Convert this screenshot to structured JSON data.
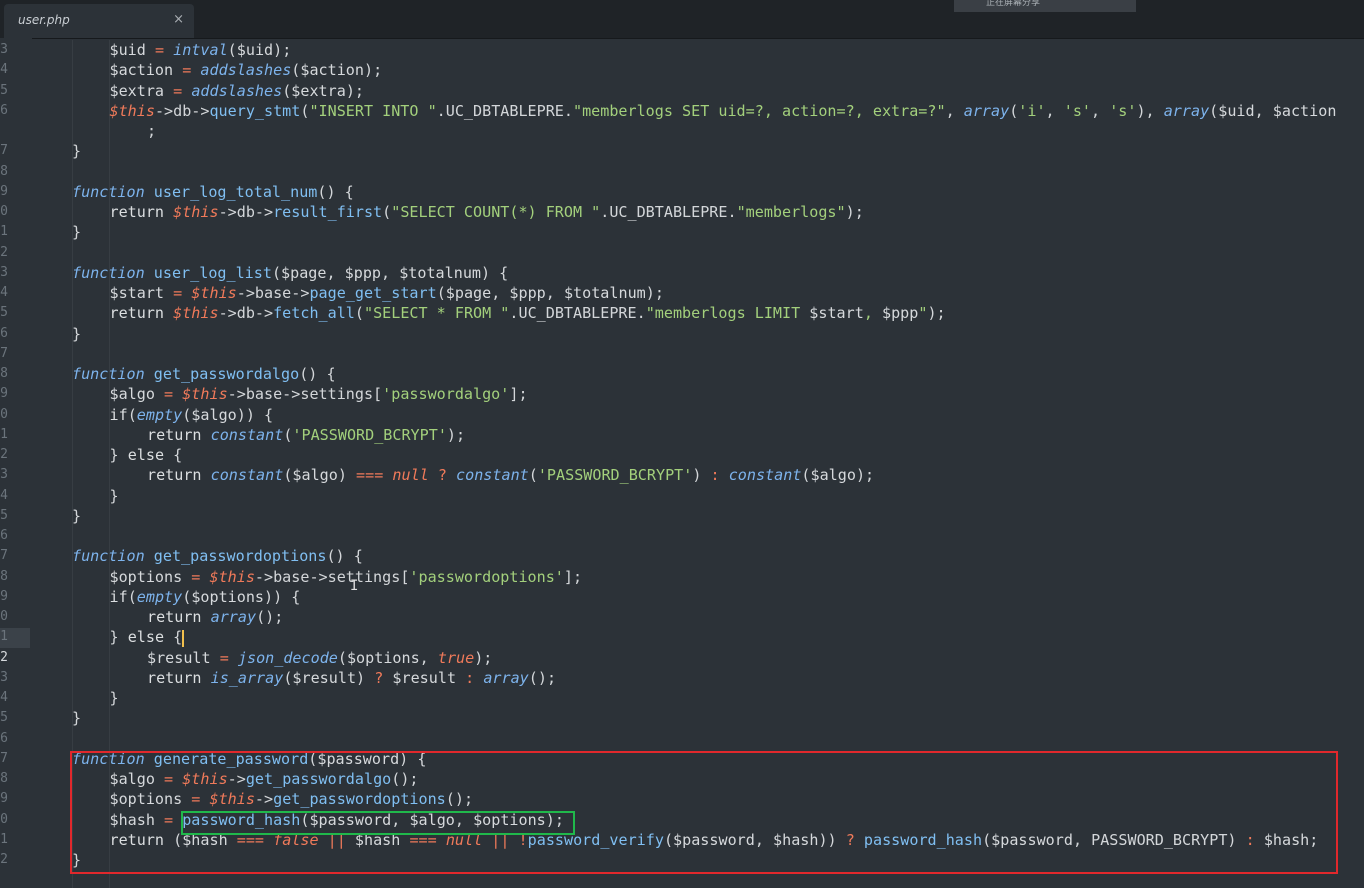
{
  "tab": {
    "title": "user.php",
    "close": "×"
  },
  "notice": {
    "text": "正在屏幕分享"
  },
  "line_numbers": [
    "3",
    "4",
    "5",
    "6",
    "",
    "7",
    "8",
    "9",
    "0",
    "1",
    "2",
    "3",
    "4",
    "5",
    "6",
    "7",
    "8",
    "9",
    "0",
    "1",
    "2",
    "3",
    "4",
    "5",
    "6",
    "7",
    "8",
    "9",
    "0",
    "1",
    "2",
    "3",
    "4",
    "5",
    "6",
    "7",
    "8",
    "9",
    "0",
    "1",
    "2"
  ],
  "code": {
    "l1": "$uid = intval($uid);",
    "l2": "$action = addslashes($action);",
    "l3": "$extra = addslashes($extra);",
    "l4": "$this->db->query_stmt(\"INSERT INTO \".UC_DBTABLEPRE.\"memberlogs SET uid=?, action=?, extra=?\", array('i', 's', 's'), array($uid, $action",
    "l5": ";",
    "l6": "}",
    "l7": "function user_log_total_num() {",
    "l8": "return $this->db->result_first(\"SELECT COUNT(*) FROM \".UC_DBTABLEPRE.\"memberlogs\");",
    "l9": "}",
    "l10": "function user_log_list($page, $ppp, $totalnum) {",
    "l11": "$start = $this->base->page_get_start($page, $ppp, $totalnum);",
    "l12": "return $this->db->fetch_all(\"SELECT * FROM \".UC_DBTABLEPRE.\"memberlogs LIMIT $start, $ppp\");",
    "l13": "}",
    "l14": "function get_passwordalgo() {",
    "l15": "$algo = $this->base->settings['passwordalgo'];",
    "l16": "if(empty($algo)) {",
    "l17": "return constant('PASSWORD_BCRYPT');",
    "l18": "} else {",
    "l19": "return constant($algo) === null ? constant('PASSWORD_BCRYPT') : constant($algo);",
    "l20": "}",
    "l21": "}",
    "l22": "function get_passwordoptions() {",
    "l23": "$options = $this->base->settings['passwordoptions'];",
    "l24": "if(empty($options)) {",
    "l25": "return array();",
    "l26": "} else {",
    "l27": "$result = json_decode($options, true);",
    "l28": "return is_array($result) ? $result : array();",
    "l29": "}",
    "l30": "}",
    "l31": "function generate_password($password) {",
    "l32": "$algo = $this->get_passwordalgo();",
    "l33": "$options = $this->get_passwordoptions();",
    "l34": "$hash = password_hash($password, $algo, $options);",
    "l35": "return ($hash === false || $hash === null || !password_verify($password, $hash)) ? password_hash($password, PASSWORD_BCRYPT) : $hash;",
    "l36": "}"
  },
  "colors": {
    "background": "#2c3238",
    "highlight_red": "#e1282c",
    "highlight_green": "#20b84b",
    "caret": "#f2c04d"
  }
}
